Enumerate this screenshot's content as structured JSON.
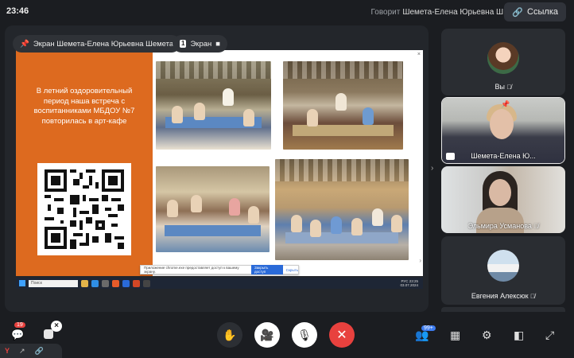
{
  "top": {
    "time": "23:46",
    "speaking_label": "Говорит",
    "speaking_name": "Шемета-Елена Юрьевна Ш.",
    "link_button": "Ссылка"
  },
  "stage": {
    "pin_pill": "Экран Шемета-Елена Юрьевна Шемета",
    "screen_badge": "1",
    "screen_pill": "Экран",
    "slide": {
      "text": "В летний оздоровительный период наша встреча с воспитанниками МБДОУ №7 повторилась в арт-кафе",
      "close_x": "×",
      "notice_text": "Приложение chrome.exe предоставляет доступ к вашему экрану.",
      "notice_button": "Закрыть доступ",
      "notice_hide": "Скрыть",
      "taskbar_search": "Поиск",
      "tray_time": "23:25",
      "tray_date": "03.07.2024",
      "tray_lang": "РУС"
    }
  },
  "participants": [
    {
      "name": "Вы",
      "type": "avatar"
    },
    {
      "name": "Шемета-Елена Ю...",
      "type": "video"
    },
    {
      "name": "Эльмира Усманова",
      "type": "video"
    },
    {
      "name": "Евгения Алексюк",
      "type": "avatar"
    }
  ],
  "controls": {
    "people_count": "99+",
    "chat_badge": "19"
  },
  "colors": {
    "end_call": "#e8413e",
    "slide_orange": "#dd6a1f",
    "accent_blue": "#3d7cf0"
  }
}
